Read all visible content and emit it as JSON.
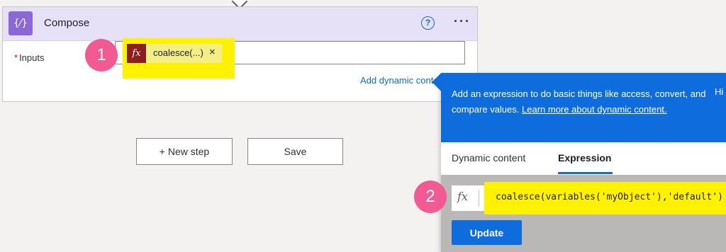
{
  "compose": {
    "title": "Compose",
    "icon_text": "{⁄}",
    "help_icon": "?",
    "more_icon": "···",
    "inputs_required_mark": "*",
    "inputs_label": "Inputs",
    "token_fx": "fx",
    "token_label": "coalesce(...)",
    "token_close": "×",
    "add_dynamic_content": "Add dynamic content"
  },
  "badges": {
    "one": "1",
    "two": "2"
  },
  "buttons": {
    "new_step": "+ New step",
    "save": "Save"
  },
  "panel": {
    "banner_text": "Add an expression to do basic things like access, convert, and compare values.",
    "banner_link": "Learn more about dynamic content.",
    "banner_hide": "Hi",
    "tabs": [
      {
        "label": "Dynamic content"
      },
      {
        "label": "Expression"
      }
    ],
    "expression_fx": "fx",
    "expression_value": "coalesce(variables('myObject'),'default')",
    "update_label": "Update"
  },
  "colors": {
    "accent_blue": "#0f6cdd",
    "highlight_yellow": "#fff200",
    "badge_pink": "#f25a94",
    "compose_purple": "#8a68d8"
  }
}
